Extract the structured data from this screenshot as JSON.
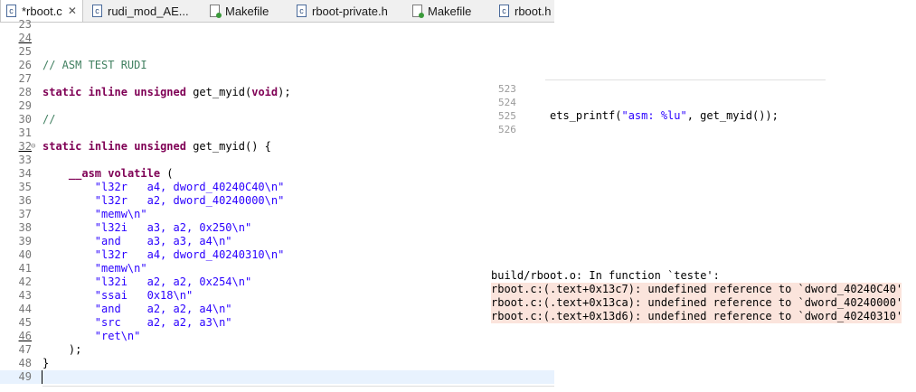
{
  "tabs": [
    {
      "icon": "c-file-icon",
      "label": "*rboot.c",
      "active": true,
      "closable": true
    },
    {
      "icon": "c-file-icon",
      "label": "rudi_mod_AE..."
    },
    {
      "icon": "makefile-icon",
      "label": "Makefile"
    },
    {
      "icon": "c-file-icon",
      "label": "rboot-private.h"
    },
    {
      "icon": "makefile-icon",
      "label": "Makefile"
    },
    {
      "icon": "c-file-icon",
      "label": "rboot.h"
    }
  ],
  "editor": {
    "lines": [
      {
        "n": "23",
        "text": ""
      },
      {
        "n": "24",
        "text": ""
      },
      {
        "n": "25",
        "text": ""
      },
      {
        "n": "26",
        "text": "// ASM TEST RUDI"
      },
      {
        "n": "27",
        "text": ""
      },
      {
        "n": "28",
        "text": "static inline unsigned get_myid(void);"
      },
      {
        "n": "29",
        "text": ""
      },
      {
        "n": "30",
        "text": "//"
      },
      {
        "n": "31",
        "text": ""
      },
      {
        "n": "32",
        "text": "static inline unsigned get_myid() {"
      },
      {
        "n": "33",
        "text": ""
      },
      {
        "n": "34",
        "text": "    __asm volatile ("
      },
      {
        "n": "35",
        "text": "        \"l32r   a4, dword_40240C40\\n\""
      },
      {
        "n": "36",
        "text": "        \"l32r   a2, dword_40240000\\n\""
      },
      {
        "n": "37",
        "text": "        \"memw\\n\""
      },
      {
        "n": "38",
        "text": "        \"l32i   a3, a2, 0x250\\n\""
      },
      {
        "n": "39",
        "text": "        \"and    a3, a3, a4\\n\""
      },
      {
        "n": "40",
        "text": "        \"l32r   a4, dword_40240310\\n\""
      },
      {
        "n": "41",
        "text": "        \"memw\\n\""
      },
      {
        "n": "42",
        "text": "        \"l32i   a2, a2, 0x254\\n\""
      },
      {
        "n": "43",
        "text": "        \"ssai   0x18\\n\""
      },
      {
        "n": "44",
        "text": "        \"and    a2, a2, a4\\n\""
      },
      {
        "n": "45",
        "text": "        \"src    a2, a2, a3\\n\""
      },
      {
        "n": "46",
        "text": "        \"ret\\n\""
      },
      {
        "n": "47",
        "text": "    );"
      },
      {
        "n": "48",
        "text": "}"
      },
      {
        "n": "49",
        "text": ""
      }
    ]
  },
  "snippet": {
    "lines": [
      {
        "n": "523",
        "text": ""
      },
      {
        "n": "524",
        "text": ""
      },
      {
        "n": "525",
        "text": "ets_printf(\"asm: %lu\", get_myid());"
      },
      {
        "n": "526",
        "text": ""
      }
    ]
  },
  "console": {
    "lines": [
      {
        "text": "build/rboot.o: In function `teste':",
        "error": false
      },
      {
        "text": "rboot.c:(.text+0x13c7): undefined reference to `dword_40240C40'",
        "error": true
      },
      {
        "text": "rboot.c:(.text+0x13ca): undefined reference to `dword_40240000'",
        "error": true
      },
      {
        "text": "rboot.c:(.text+0x13d6): undefined reference to `dword_40240310'",
        "error": true
      }
    ]
  },
  "colors": {
    "keyword": "#7f0055",
    "comment": "#3f7f5f",
    "string": "#2a00ff",
    "current_line": "#e8f2fe",
    "error_bg": "#fbe4dc"
  }
}
